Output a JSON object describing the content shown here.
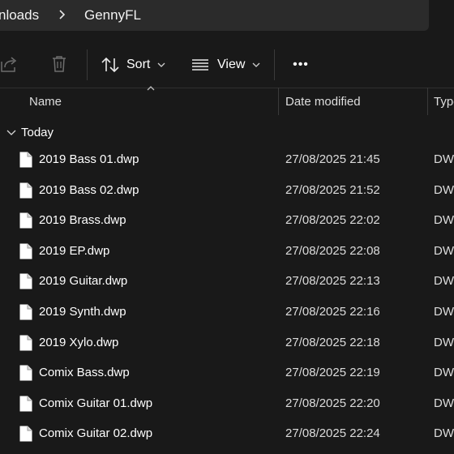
{
  "breadcrumb": {
    "parent": "nloads",
    "current": "GennyFL"
  },
  "toolbar": {
    "sort_label": "Sort",
    "view_label": "View",
    "more_label": "•••"
  },
  "columns": {
    "name": "Name",
    "date_modified": "Date modified",
    "type": "Type"
  },
  "group": {
    "label": "Today"
  },
  "files": [
    {
      "name": "2019 Bass 01.dwp",
      "date": "27/08/2025 21:45",
      "type": "DW"
    },
    {
      "name": "2019 Bass 02.dwp",
      "date": "27/08/2025 21:52",
      "type": "DW"
    },
    {
      "name": "2019 Brass.dwp",
      "date": "27/08/2025 22:02",
      "type": "DW"
    },
    {
      "name": "2019 EP.dwp",
      "date": "27/08/2025 22:08",
      "type": "DW"
    },
    {
      "name": "2019 Guitar.dwp",
      "date": "27/08/2025 22:13",
      "type": "DW"
    },
    {
      "name": "2019 Synth.dwp",
      "date": "27/08/2025 22:16",
      "type": "DW"
    },
    {
      "name": "2019 Xylo.dwp",
      "date": "27/08/2025 22:18",
      "type": "DW"
    },
    {
      "name": "Comix Bass.dwp",
      "date": "27/08/2025 22:19",
      "type": "DW"
    },
    {
      "name": "Comix Guitar 01.dwp",
      "date": "27/08/2025 22:20",
      "type": "DW"
    },
    {
      "name": "Comix Guitar 02.dwp",
      "date": "27/08/2025 22:24",
      "type": "DW"
    }
  ],
  "icons": {
    "share": "share-icon",
    "delete": "trash-icon",
    "sort": "sort-arrows-icon",
    "view": "view-lines-icon",
    "file": "file-icon"
  },
  "colors": {
    "background": "#191919",
    "addressbar": "#2b2b2b",
    "text": "#ffffff"
  }
}
